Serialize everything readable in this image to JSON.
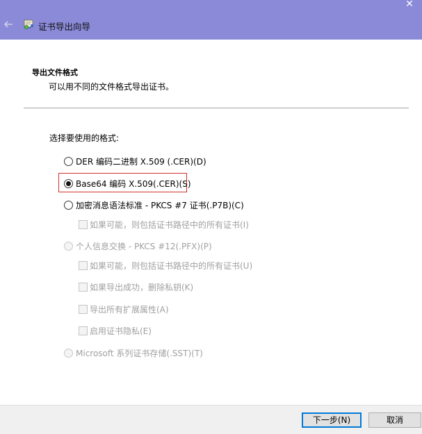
{
  "window": {
    "title": "证书导出向导",
    "close_glyph": "✕"
  },
  "page": {
    "section_title": "导出文件格式",
    "section_desc": "可以用不同的文件格式导出证书。",
    "prompt": "选择要使用的格式:"
  },
  "options": {
    "der": {
      "label": "DER 编码二进制 X.509 (.CER)(D)",
      "selected": false,
      "enabled": true
    },
    "base64": {
      "label": "Base64 编码 X.509(.CER)(S)",
      "selected": true,
      "enabled": true
    },
    "pkcs7": {
      "label": "加密消息语法标准 - PKCS #7 证书(.P7B)(C)",
      "selected": false,
      "enabled": true
    },
    "pkcs7_include": {
      "label": "如果可能，则包括证书路径中的所有证书(I)",
      "checked": false,
      "enabled": false
    },
    "pkcs12": {
      "label": "个人信息交换 - PKCS #12(.PFX)(P)",
      "selected": false,
      "enabled": false
    },
    "pkcs12_include": {
      "label": "如果可能，则包括证书路径中的所有证书(U)",
      "checked": false,
      "enabled": false
    },
    "pkcs12_delete_key": {
      "label": "如果导出成功，删除私钥(K)",
      "checked": false,
      "enabled": false
    },
    "pkcs12_export_ext": {
      "label": "导出所有扩展属性(A)",
      "checked": false,
      "enabled": false
    },
    "pkcs12_privacy": {
      "label": "启用证书隐私(E)",
      "checked": false,
      "enabled": false
    },
    "sst": {
      "label": "Microsoft 系列证书存储(.SST)(T)",
      "selected": false,
      "enabled": false
    }
  },
  "buttons": {
    "next": "下一步(N)",
    "cancel": "取消"
  },
  "colors": {
    "titlebar": "#8b8ad9",
    "highlight_border": "#d0302b",
    "primary_border": "#0078d7"
  }
}
